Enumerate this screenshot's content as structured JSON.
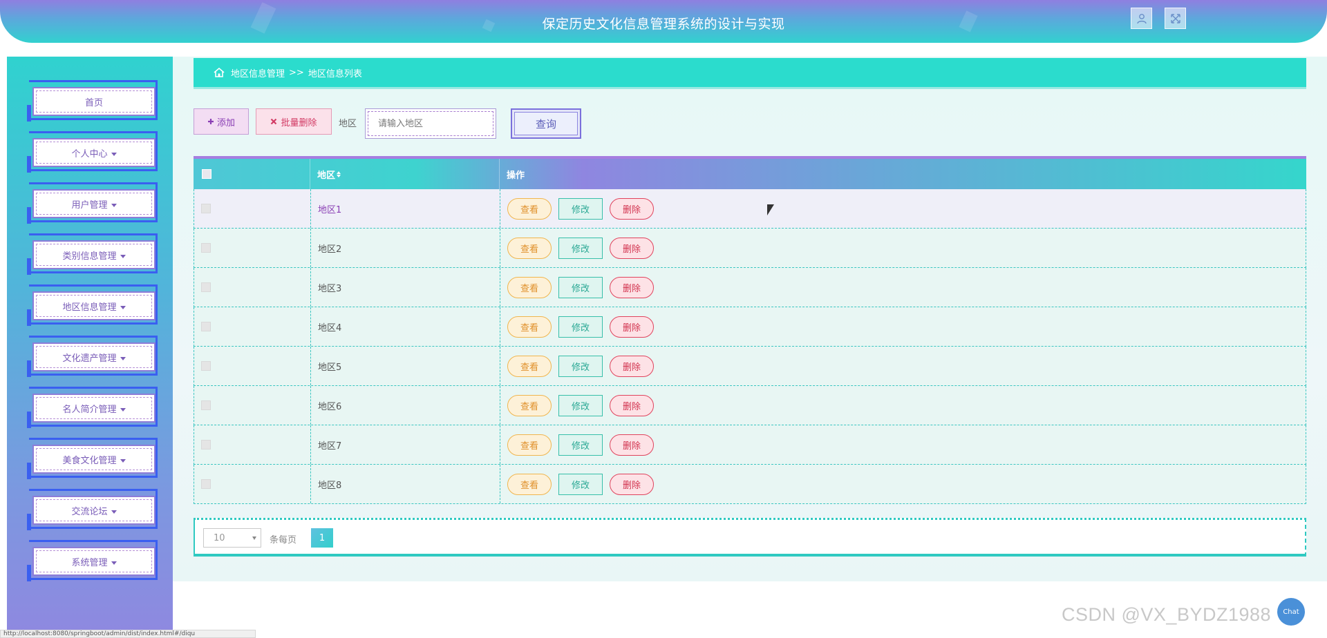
{
  "header": {
    "title": "保定历史文化信息管理系统的设计与实现",
    "user_icon": "user-icon",
    "fullscreen_icon": "fullscreen-icon"
  },
  "sidebar": {
    "items": [
      {
        "label": "首页",
        "has_caret": false
      },
      {
        "label": "个人中心",
        "has_caret": true
      },
      {
        "label": "用户管理",
        "has_caret": true
      },
      {
        "label": "类别信息管理",
        "has_caret": true
      },
      {
        "label": "地区信息管理",
        "has_caret": true
      },
      {
        "label": "文化遗产管理",
        "has_caret": true
      },
      {
        "label": "名人简介管理",
        "has_caret": true
      },
      {
        "label": "美食文化管理",
        "has_caret": true
      },
      {
        "label": "交流论坛",
        "has_caret": true
      },
      {
        "label": "系统管理",
        "has_caret": true
      }
    ]
  },
  "breadcrumb": {
    "icon": "home-icon",
    "parent": "地区信息管理",
    "separator": ">>",
    "current": "地区信息列表"
  },
  "toolbar": {
    "add_label": "添加",
    "batch_delete_label": "批量删除",
    "region_label": "地区",
    "search_placeholder": "请输入地区",
    "query_label": "查询"
  },
  "table": {
    "headers": {
      "region": "地区",
      "actions": "操作"
    },
    "rows": [
      {
        "name": "地区1"
      },
      {
        "name": "地区2"
      },
      {
        "name": "地区3"
      },
      {
        "name": "地区4"
      },
      {
        "name": "地区5"
      },
      {
        "name": "地区6"
      },
      {
        "name": "地区7"
      },
      {
        "name": "地区8"
      }
    ],
    "actions": {
      "view": "查看",
      "edit": "修改",
      "delete": "删除"
    }
  },
  "pagination": {
    "page_size": "10",
    "per_page_label": "条每页",
    "current_page": "1"
  },
  "status_bar": {
    "url": "http://localhost:8080/springboot/admin/dist/index.html#/diqu"
  },
  "float_button": {
    "label": "Chat"
  },
  "watermark": "CSDN @VX_BYDZ1988",
  "colors": {
    "accent_teal": "#2bdccd",
    "accent_purple": "#8f7fe0",
    "view": "#e0902a",
    "edit": "#2aa894",
    "delete": "#d2334f"
  }
}
